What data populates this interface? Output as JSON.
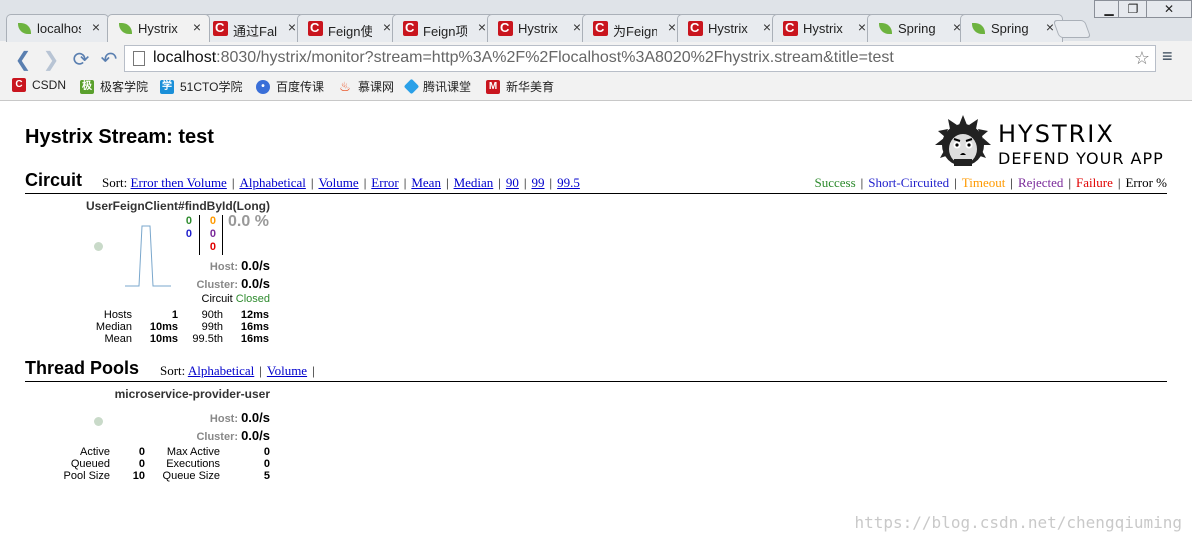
{
  "browser": {
    "tabs": [
      {
        "label": "localhost",
        "icon": "spring-leaf-icon"
      },
      {
        "label": "Hystrix",
        "icon": "spring-leaf-icon"
      },
      {
        "label": "通过Fall",
        "icon": "csdn-icon"
      },
      {
        "label": "Feign使",
        "icon": "csdn-icon"
      },
      {
        "label": "Feign项",
        "icon": "csdn-icon"
      },
      {
        "label": "Hystrix",
        "icon": "csdn-icon"
      },
      {
        "label": "为Feign",
        "icon": "csdn-icon"
      },
      {
        "label": "Hystrix",
        "icon": "csdn-icon"
      },
      {
        "label": "Hystrix",
        "icon": "csdn-icon"
      },
      {
        "label": "Spring",
        "icon": "spring-icon"
      },
      {
        "label": "Spring",
        "icon": "spring-icon"
      }
    ],
    "active_tab": 1,
    "url_host": "localhost",
    "url_rest": ":8030/hystrix/monitor?stream=http%3A%2F%2Flocalhost%3A8020%2Fhystrix.stream&title=test",
    "bookmarks": [
      "CSDN",
      "极客学院",
      "51CTO学院",
      "百度传课",
      "慕课网",
      "腾讯课堂",
      "新华美育"
    ]
  },
  "page": {
    "title": "Hystrix Stream: test",
    "logo_title": "HYSTRIX",
    "logo_subtitle": "DEFEND YOUR APP"
  },
  "circuit": {
    "heading": "Circuit",
    "sort_label": "Sort:",
    "sort_options": [
      "Error then Volume",
      "Alphabetical",
      "Volume",
      "Error",
      "Mean",
      "Median",
      "90",
      "99",
      "99.5"
    ],
    "legend": [
      {
        "label": "Success",
        "color": "#2e8b2e"
      },
      {
        "label": "Short-Circuited",
        "color": "#1f1fcc"
      },
      {
        "label": "Timeout",
        "color": "#ff9a00"
      },
      {
        "label": "Rejected",
        "color": "#7a2a9a"
      },
      {
        "label": "Failure",
        "color": "#e00000"
      },
      {
        "label": "Error %",
        "color": "#000000"
      }
    ],
    "monitor": {
      "name": "UserFeignClient#findById(Long)",
      "success": "0",
      "short_circuited": "0",
      "timeout": "0",
      "rejected": "0",
      "failure": "0",
      "error_pct": "0.0 %",
      "host_label": "Host:",
      "host_rate": "0.0/s",
      "cluster_label": "Cluster:",
      "cluster_rate": "0.0/s",
      "circuit_label": "Circuit",
      "circuit_status": "Closed",
      "hosts_label": "Hosts",
      "hosts": "1",
      "median_label": "Median",
      "median": "10ms",
      "mean_label": "Mean",
      "mean": "10ms",
      "p90_label": "90th",
      "p90": "12ms",
      "p99_label": "99th",
      "p99": "16ms",
      "p995_label": "99.5th",
      "p995": "16ms"
    }
  },
  "threadpools": {
    "heading": "Thread Pools",
    "sort_label": "Sort:",
    "sort_options": [
      "Alphabetical",
      "Volume"
    ],
    "monitor": {
      "name": "microservice-provider-user",
      "host_label": "Host:",
      "host_rate": "0.0/s",
      "cluster_label": "Cluster:",
      "cluster_rate": "0.0/s",
      "active_label": "Active",
      "active": "0",
      "queued_label": "Queued",
      "queued": "0",
      "poolsize_label": "Pool Size",
      "poolsize": "10",
      "maxactive_label": "Max Active",
      "maxactive": "0",
      "executions_label": "Executions",
      "executions": "0",
      "queuesize_label": "Queue Size",
      "queuesize": "5"
    }
  },
  "watermark": "https://blog.csdn.net/chengqiuming"
}
